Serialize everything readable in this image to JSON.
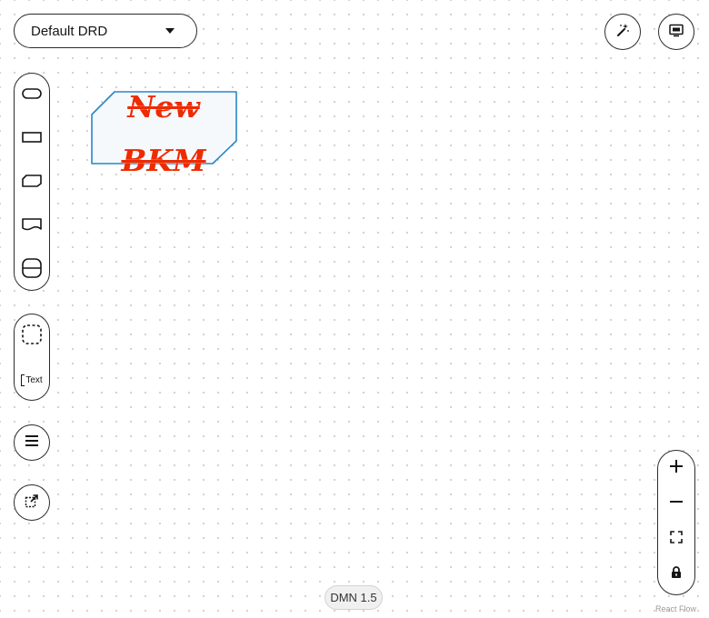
{
  "drd_selector": {
    "value": "Default DRD"
  },
  "top_right": {
    "icons": [
      "magic-wand-icon",
      "overlays-icon"
    ]
  },
  "palette": {
    "nodes": [
      "decision-icon",
      "input-data-icon",
      "bkm-icon",
      "knowledge-source-icon",
      "decision-service-icon"
    ],
    "extras": {
      "group_icon": "group-icon",
      "text_annotation_label": "Text"
    }
  },
  "canvas": {
    "node": {
      "type": "bkm",
      "label": "New BKM",
      "label_line_1": "New",
      "label_line_2": "BKM",
      "label_color": "#ee2a00",
      "fill": "#f5f9fc",
      "stroke": "#2a86c4"
    }
  },
  "zoom_controls": {
    "items": [
      "zoom-in-icon",
      "zoom-out-icon",
      "fit-view-icon",
      "lock-icon"
    ]
  },
  "footer": {
    "version": "DMN 1.5",
    "attribution": "React Flow"
  }
}
